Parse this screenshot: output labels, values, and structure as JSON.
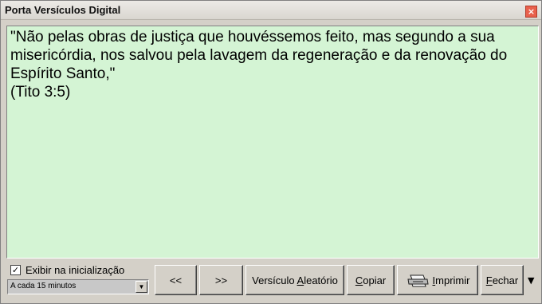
{
  "window": {
    "title": "Porta Versículos Digital",
    "close_glyph": "×"
  },
  "verse": {
    "text": "\"Não pelas obras de justiça que houvéssemos feito, mas segundo a sua misericórdia, nos salvou pela lavagem da regeneração e da renovação do Espírito Santo,\"",
    "reference": "(Tito 3:5)"
  },
  "options": {
    "show_on_startup_label": "Exibir na inicialização",
    "show_on_startup_checked": true,
    "check_glyph": "✓",
    "interval_value": "A cada 15 minutos",
    "dropdown_glyph": "▼"
  },
  "buttons": {
    "prev": "<<",
    "next": ">>",
    "random_prefix": "Versículo ",
    "random_access": "A",
    "random_suffix": "leatório",
    "copy_access": "C",
    "copy_suffix": "opiar",
    "print_access": "I",
    "print_suffix": "mprimir",
    "close_access": "F",
    "close_suffix": "echar",
    "more_glyph": "▼"
  },
  "icons": {
    "printer": "printer-icon",
    "close": "close-icon"
  }
}
